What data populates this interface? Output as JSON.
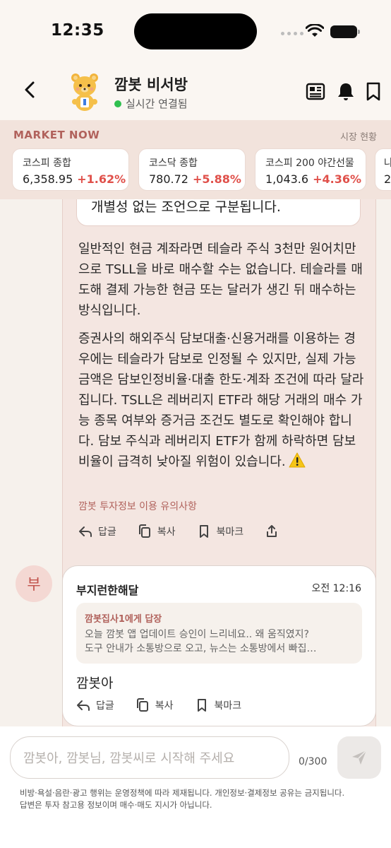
{
  "status_bar": {
    "time": "12:35"
  },
  "header": {
    "title": "깜봇 비서방",
    "status": "실시간 연결됨"
  },
  "market": {
    "title": "MARKET NOW",
    "subtitle": "시장 현황",
    "cards": [
      {
        "name": "코스피 종합",
        "value": "6,358.95",
        "change": "+1.62%"
      },
      {
        "name": "코스닥 종합",
        "value": "780.72",
        "change": "+5.88%"
      },
      {
        "name": "코스피 200 야간선물",
        "value": "1,043.6",
        "change": "+4.36%"
      },
      {
        "name": "나",
        "value": "2",
        "change": ""
      }
    ]
  },
  "bot_message": {
    "quote_text": "개별성 없는 조언으로 구분됩니다.",
    "paragraph1": "일반적인 현금 계좌라면 테슬라 주식 3천만 원어치만으로 TSLL을 바로 매수할 수는 없습니다. 테슬라를 매도해 결제 가능한 현금 또는 달러가 생긴 뒤 매수하는 방식입니다.",
    "paragraph2": "증권사의 해외주식 담보대출·신용거래를 이용하는 경우에는 테슬라가 담보로 인정될 수 있지만, 실제 가능 금액은 담보인정비율·대출 한도·계좌 조건에 따라 달라집니다. TSLL은 레버리지 ETF라 해당 거래의 매수 가능 종목 여부와 증거금 조건도 별도로 확인해야 합니다. 담보 주식과 레버리지 ETF가 함께 하락하면 담보비율이 급격히 낮아질 위험이 있습니다.",
    "disclaimer": "깜봇 투자정보 이용 유의사항",
    "actions": {
      "reply": "답글",
      "copy": "복사",
      "bookmark": "북마크"
    }
  },
  "user_message": {
    "avatar_char": "부",
    "name": "부지런한해달",
    "time": "오전 12:16",
    "reply_to": "깜봇집사1에게 답장",
    "reply_line1": "오늘 깜봇 앱 업데이트 승인이 느리네요.. 왜 움직였지?",
    "reply_line2": "도구 안내가 소통방으로 오고, 뉴스는 소통방에서 빠집…",
    "text": "깜봇아",
    "actions": {
      "reply": "답글",
      "copy": "복사",
      "bookmark": "북마크"
    }
  },
  "composer": {
    "placeholder": "깜봇아, 깜봇님, 깜봇씨로 시작해 주세요",
    "counter": "0/300",
    "policy_line1": "비방·욕설·음란·광고 행위는 운영정책에 따라 제재됩니다. 개인정보·결제정보 공유는 금지됩니다.",
    "policy_line2": "답변은 투자 참고용 정보이며 매수·매도 지시가 아닙니다."
  },
  "colors": {
    "accent": "#b1625c",
    "up": "#e0504a",
    "online": "#2fbf4f",
    "bot_bubble": "#f4e6e1",
    "market_bg": "#f2e3dc"
  }
}
